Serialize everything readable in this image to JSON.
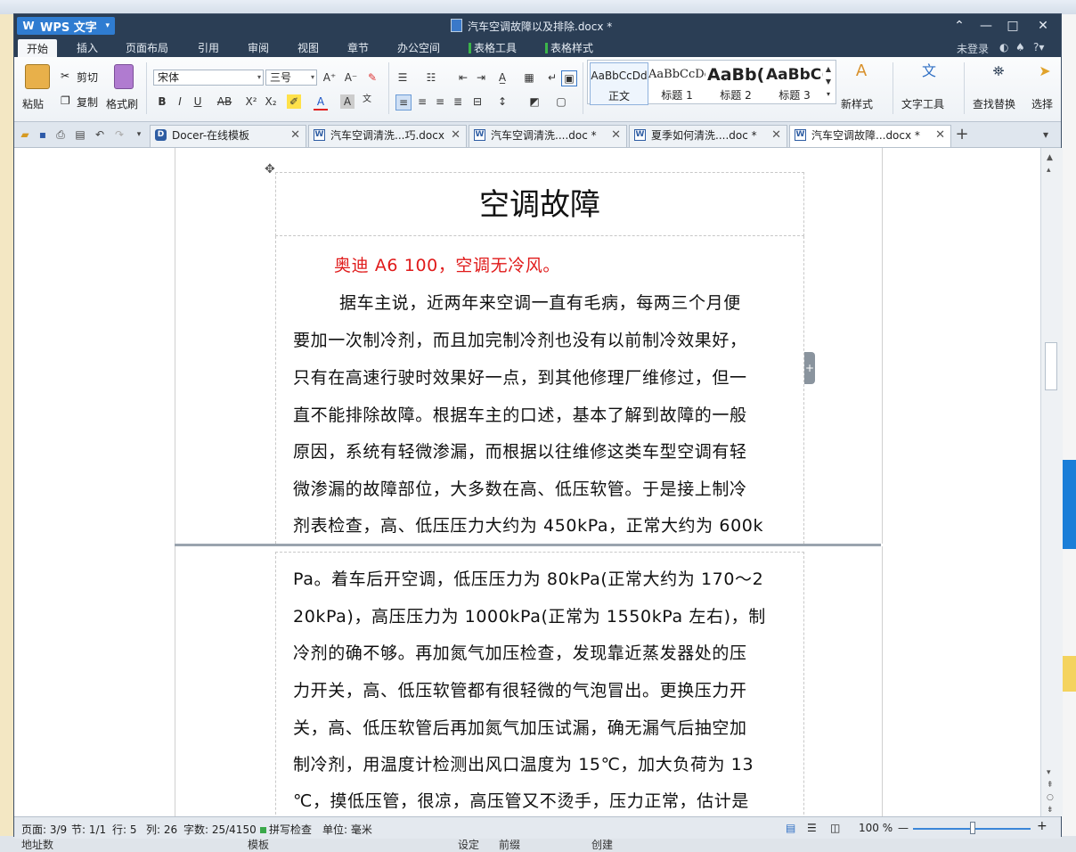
{
  "app": {
    "name": "WPS 文字",
    "document_title": "汽车空调故障以及排除.docx *"
  },
  "window_controls": {
    "help": "⌃",
    "minimize": "—",
    "maximize": "□",
    "close": "✕"
  },
  "menu": {
    "items": [
      "开始",
      "插入",
      "页面布局",
      "引用",
      "审阅",
      "视图",
      "章节",
      "办公空间"
    ],
    "table_tools": "表格工具",
    "table_styles": "表格样式",
    "login": "未登录"
  },
  "ribbon": {
    "paste": "粘贴",
    "cut": "剪切",
    "copy": "复制",
    "format_painter": "格式刷",
    "font_name": "宋体",
    "font_size": "三号",
    "styles": [
      {
        "sample": "AaBbCcDd",
        "label": "正文"
      },
      {
        "sample": "AaBbCcDc",
        "label": "标题 1"
      },
      {
        "sample": "AaBb(",
        "label": "标题 2"
      },
      {
        "sample": "AaBbC(",
        "label": "标题 3"
      }
    ],
    "new_style": "新样式",
    "text_tools": "文字工具",
    "find_replace": "查找替换",
    "select": "选择"
  },
  "tabs": [
    {
      "label": "Docer-在线模板",
      "active": false
    },
    {
      "label": "汽车空调清洗...巧.docx",
      "active": false
    },
    {
      "label": "汽车空调清洗....doc *",
      "active": false
    },
    {
      "label": "夏季如何清洗....doc *",
      "active": false
    },
    {
      "label": "汽车空调故障...docx *",
      "active": true
    }
  ],
  "document": {
    "heading": "空调故障",
    "subtitle_red": "奥迪 A6 100，空调无冷风。",
    "page1_lines": [
      "据车主说，近两年来空调一直有毛病，每两三个月便",
      "要加一次制冷剂，而且加完制冷剂也没有以前制冷效果好，",
      "只有在高速行驶时效果好一点，到其他修理厂维修过，但一",
      "直不能排除故障。根据车主的口述，基本了解到故障的一般",
      "原因，系统有轻微渗漏，而根据以往维修这类车型空调有轻",
      "微渗漏的故障部位，大多数在高、低压软管。于是接上制冷",
      "剂表检查，高、低压压力大约为 450kPa，正常大约为 600k"
    ],
    "page2_lines": [
      "Pa。着车后开空调，低压压力为 80kPa(正常大约为 170～2",
      "20kPa)，高压压力为 1000kPa(正常为 1550kPa 左右)，制",
      "冷剂的确不够。再加氮气加压检查，发现靠近蒸发器处的压",
      "力开关，高、低压软管都有很轻微的气泡冒出。更换压力开",
      "关，高、低压软管后再加氮气加压试漏，确无漏气后抽空加",
      "制冷剂，用温度计检测出风口温度为 15℃，加大负荷为 13",
      "℃，摸低压管，很凉，高压管又不烫手，压力正常，估计是"
    ]
  },
  "status": {
    "page": "页面: 3/9",
    "section": "节: 1/1",
    "row": "行: 5",
    "col": "列: 26",
    "words": "字数: 25/4150",
    "spell": "拼写检查",
    "unit": "单位: 毫米",
    "zoom": "100 %"
  },
  "background": {
    "bottom_texts": [
      "地址数",
      "模板",
      "设定",
      "前缀",
      "创建"
    ]
  },
  "colors": {
    "titlebar": "#2b3e55",
    "accent": "#2f7cd1",
    "red_text": "#e01a1a"
  }
}
